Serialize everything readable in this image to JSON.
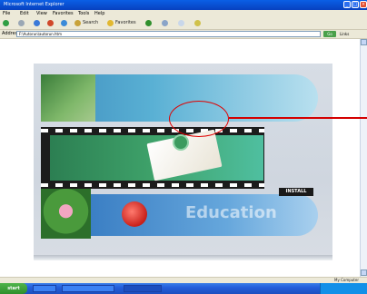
{
  "window": {
    "title": "Microsoft Internet Explorer"
  },
  "menubar": {
    "items": [
      "File",
      "Edit",
      "View",
      "Favorites",
      "Tools",
      "Help"
    ]
  },
  "toolbar": {
    "back_label": "Back",
    "search_label": "Search",
    "favorites_label": "Favorites"
  },
  "addressbar": {
    "label": "Address",
    "value": "F:\\Autorun\\autorun.htm",
    "go_label": "Go",
    "links_label": "Links"
  },
  "page": {
    "banner_title": "",
    "nav_links": [
      "",
      "",
      "",
      "",
      ""
    ],
    "film_caption": "",
    "edu_word": "Education",
    "logo_text_lines": [
      "",
      ""
    ],
    "right_menu": [
      "",
      "",
      "",
      "",
      "",
      "",
      ""
    ],
    "year_label": "",
    "install_button_label": "INSTALL"
  },
  "statusbar": {
    "zone": "My Computer"
  },
  "taskbar": {
    "start_label": "start",
    "tasks": [
      "",
      "",
      ""
    ],
    "clock": ""
  },
  "colors": {
    "annotation": "#e00000",
    "banner": "#59b0d4",
    "film_green": "#3fa36b",
    "taskbar": "#245edb"
  }
}
